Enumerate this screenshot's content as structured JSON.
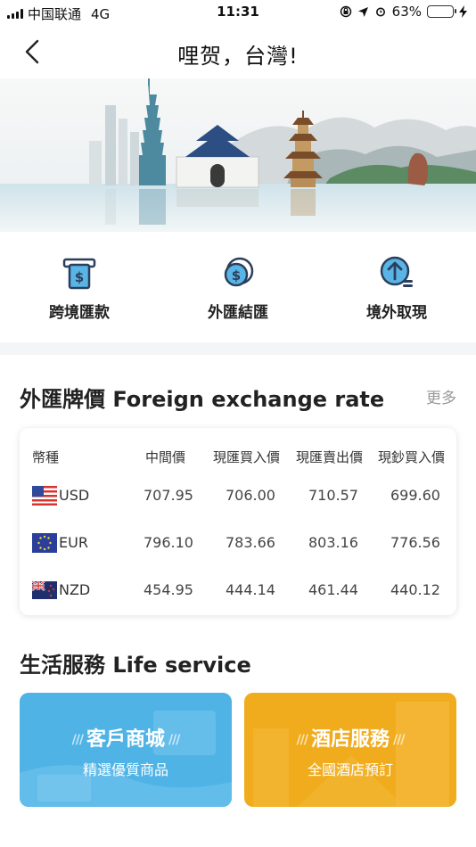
{
  "status_bar": {
    "carrier": "中国联通",
    "network": "4G",
    "time": "11:31",
    "battery": "63%",
    "battery_level": 0.63
  },
  "nav": {
    "title": "哩贺，台灣!"
  },
  "quick_actions": [
    {
      "label": "跨境匯款",
      "icon": "atm-dollar-icon"
    },
    {
      "label": "外匯結匯",
      "icon": "coin-exchange-icon"
    },
    {
      "label": "境外取現",
      "icon": "upload-coin-icon"
    }
  ],
  "forex": {
    "title": "外匯牌價 Foreign exchange rate",
    "more": "更多",
    "headers": [
      "幣種",
      "中間價",
      "現匯買入價",
      "現匯賣出價",
      "現鈔買入價"
    ],
    "rows": [
      {
        "code": "USD",
        "flag": "us-flag-icon",
        "values": [
          "707.95",
          "706.00",
          "710.57",
          "699.60"
        ]
      },
      {
        "code": "EUR",
        "flag": "eu-flag-icon",
        "values": [
          "796.10",
          "783.66",
          "803.16",
          "776.56"
        ]
      },
      {
        "code": "NZD",
        "flag": "nz-flag-icon",
        "values": [
          "454.95",
          "444.14",
          "461.44",
          "440.12"
        ]
      }
    ]
  },
  "life": {
    "title": "生活服務 Life service",
    "cards": [
      {
        "title": "客戶商城",
        "subtitle": "精選優質商品",
        "color": "#4fb3e6"
      },
      {
        "title": "酒店服務",
        "subtitle": "全國酒店預訂",
        "color": "#f0ac1d"
      }
    ]
  },
  "colors": {
    "accent": "#1a8fd6",
    "more_text": "#999999"
  }
}
